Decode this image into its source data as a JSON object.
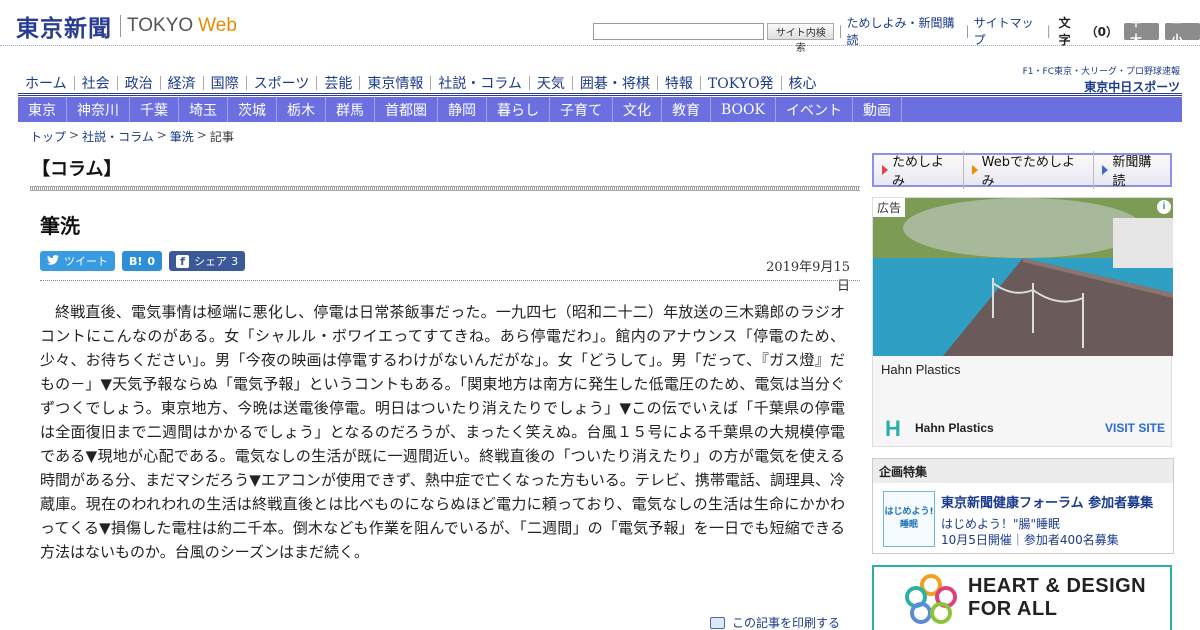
{
  "header": {
    "logo_text": "東京新聞",
    "logo_web_1": "TOKYO",
    "logo_web_2": "Web",
    "search_button": "サイト内検索",
    "link_trial_subscribe": "ためしよみ・新聞購読",
    "link_sitemap": "サイトマップ",
    "font_size_label": "文字",
    "font_size_value": "（0）",
    "font_larger": "＋大",
    "font_smaller": "－小"
  },
  "nav_primary": [
    "ホーム",
    "社会",
    "政治",
    "経済",
    "国際",
    "スポーツ",
    "芸能",
    "東京情報",
    "社説・コラム",
    "天気",
    "囲碁・将棋",
    "特報",
    "TOKYO発",
    "核心"
  ],
  "sports_banner": {
    "top": "F1・FC東京・大リーグ・プロ野球速報",
    "logo": "東京中日スポーツ"
  },
  "nav_regional": [
    "東京",
    "神奈川",
    "千葉",
    "埼玉",
    "茨城",
    "栃木",
    "群馬",
    "首都圏",
    "静岡",
    "暮らし",
    "子育て",
    "文化",
    "教育",
    "BOOK",
    "イベント",
    "動画"
  ],
  "breadcrumb": [
    "トップ",
    "社説・コラム",
    "筆洗",
    "記事"
  ],
  "section_title": "【コラム】",
  "article": {
    "title": "筆洗",
    "date": "2019年9月15日",
    "body": "終戦直後、電気事情は極端に悪化し、停電は日常茶飯事だった。一九四七（昭和二十二）年放送の三木鶏郎のラジオコントにこんなのがある。女「シャルル・ボワイエってすてきね。あら停電だわ」。館内のアナウンス「停電のため、少々、お待ちください」。男「今夜の映画は停電するわけがないんだがな」。女「どうして」。男「だって、『ガス燈』だもの－」▼天気予報ならぬ「電気予報」というコントもある。「関東地方は南方に発生した低電圧のため、電気は当分ぐずつくでしょう。東京地方、今晩は送電後停電。明日はついたり消えたりでしょう」▼この伝でいえば「千葉県の停電は全面復旧まで二週間はかかるでしょう」となるのだろうが、まったく笑えぬ。台風１５号による千葉県の大規模停電である▼現地が心配である。電気なしの生活が既に一週間近い。終戦直後の「ついたり消えたり」の方が電気を使える時間がある分、まだマシだろう▼エアコンが使用できず、熱中症で亡くなった方もいる。テレビ、携帯電話、調理具、冷蔵庫。現在のわれわれの生活は終戦直後とは比べものにならぬほど電力に頼っており、電気なしの生活は生命にかかわってくる▼損傷した電柱は約二千本。倒木なども作業を阻んでいるが、「二週間」の「電気予報」を一日でも短縮できる方法はないものか。台風のシーズンはまだ続く。"
  },
  "social": {
    "tweet_label": "ツイート",
    "hatena_icon": "B!",
    "hatena_count": "0",
    "facebook_icon": "f",
    "facebook_label": "シェア",
    "facebook_count": "3"
  },
  "print_label": "この記事を印刷する",
  "subscribe_bar": [
    "ためしよみ",
    "Webでためしよみ",
    "新聞購読"
  ],
  "ad": {
    "label": "広告",
    "info": "i",
    "headline": "Hahn Plastics",
    "logo": "H",
    "brand": "Hahn Plastics",
    "cta": "VISIT SITE"
  },
  "feature": {
    "head": "企画特集",
    "thumb_text": "はじめよう!睡眠",
    "title": "東京新聞健康フォーラム 参加者募集",
    "subtitle": "はじめよう！\"腸\"睡眠",
    "date": "10月5日開催｜参加者400名募集"
  },
  "heart_banner": {
    "line1": "HEART & DESIGN",
    "line2": "FOR ALL"
  },
  "colors": {
    "brand_navy": "#2a3c92",
    "nav_purple": "#6b6fe0",
    "link": "#1a3a8c",
    "web_orange": "#e68a00"
  }
}
